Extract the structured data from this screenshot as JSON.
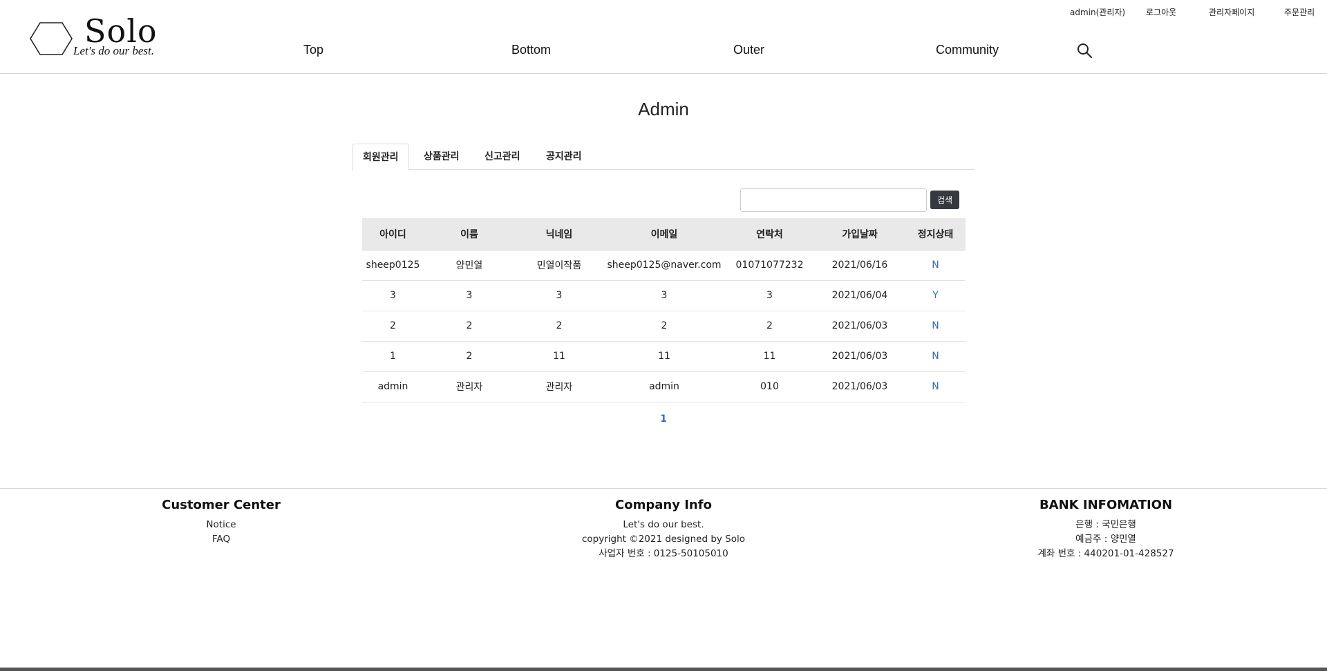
{
  "brand": {
    "name": "Solo",
    "slogan": "Let's do our best."
  },
  "top_links": [
    "admin(관리자)",
    "로그아웃",
    "관리자페이지",
    "주문관리"
  ],
  "main_nav": [
    "Top",
    "Bottom",
    "Outer",
    "Community"
  ],
  "page": {
    "title": "Admin"
  },
  "tabs": [
    "회원관리",
    "상품관리",
    "신고관리",
    "공지관리"
  ],
  "search": {
    "value": "",
    "placeholder": "",
    "button_label": "검색"
  },
  "table": {
    "headers": [
      "아이디",
      "이름",
      "닉네임",
      "이메일",
      "연락처",
      "가입날짜",
      "정지상태"
    ],
    "rows": [
      [
        "sheep0125",
        "양민열",
        "민열이작품",
        "sheep0125@naver.com",
        "01071077232",
        "2021/06/16",
        "N"
      ],
      [
        "3",
        "3",
        "3",
        "3",
        "3",
        "2021/06/04",
        "Y"
      ],
      [
        "2",
        "2",
        "2",
        "2",
        "2",
        "2021/06/03",
        "N"
      ],
      [
        "1",
        "2",
        "11",
        "11",
        "11",
        "2021/06/03",
        "N"
      ],
      [
        "admin",
        "관리자",
        "관리자",
        "admin",
        "010",
        "2021/06/03",
        "N"
      ]
    ]
  },
  "pagination": {
    "current": "1"
  },
  "footer": {
    "customer": {
      "title": "Customer Center",
      "links": [
        "Notice",
        "FAQ"
      ]
    },
    "company": {
      "title": "Company Info",
      "lines": [
        "Let's do our best.",
        "copyright ©2021 designed by Solo",
        "사업자 번호 : 0125-50105010"
      ]
    },
    "bank": {
      "title": "BANK INFOMATION",
      "lines": [
        "은행 : 국민은행",
        "예금주 : 양민열",
        "계좌 번호 : 440201-01-428527"
      ]
    }
  },
  "colors": {
    "link_blue": "#1e73d8",
    "button_dark": "#343a40",
    "header_gray": "#e9e9e9"
  }
}
